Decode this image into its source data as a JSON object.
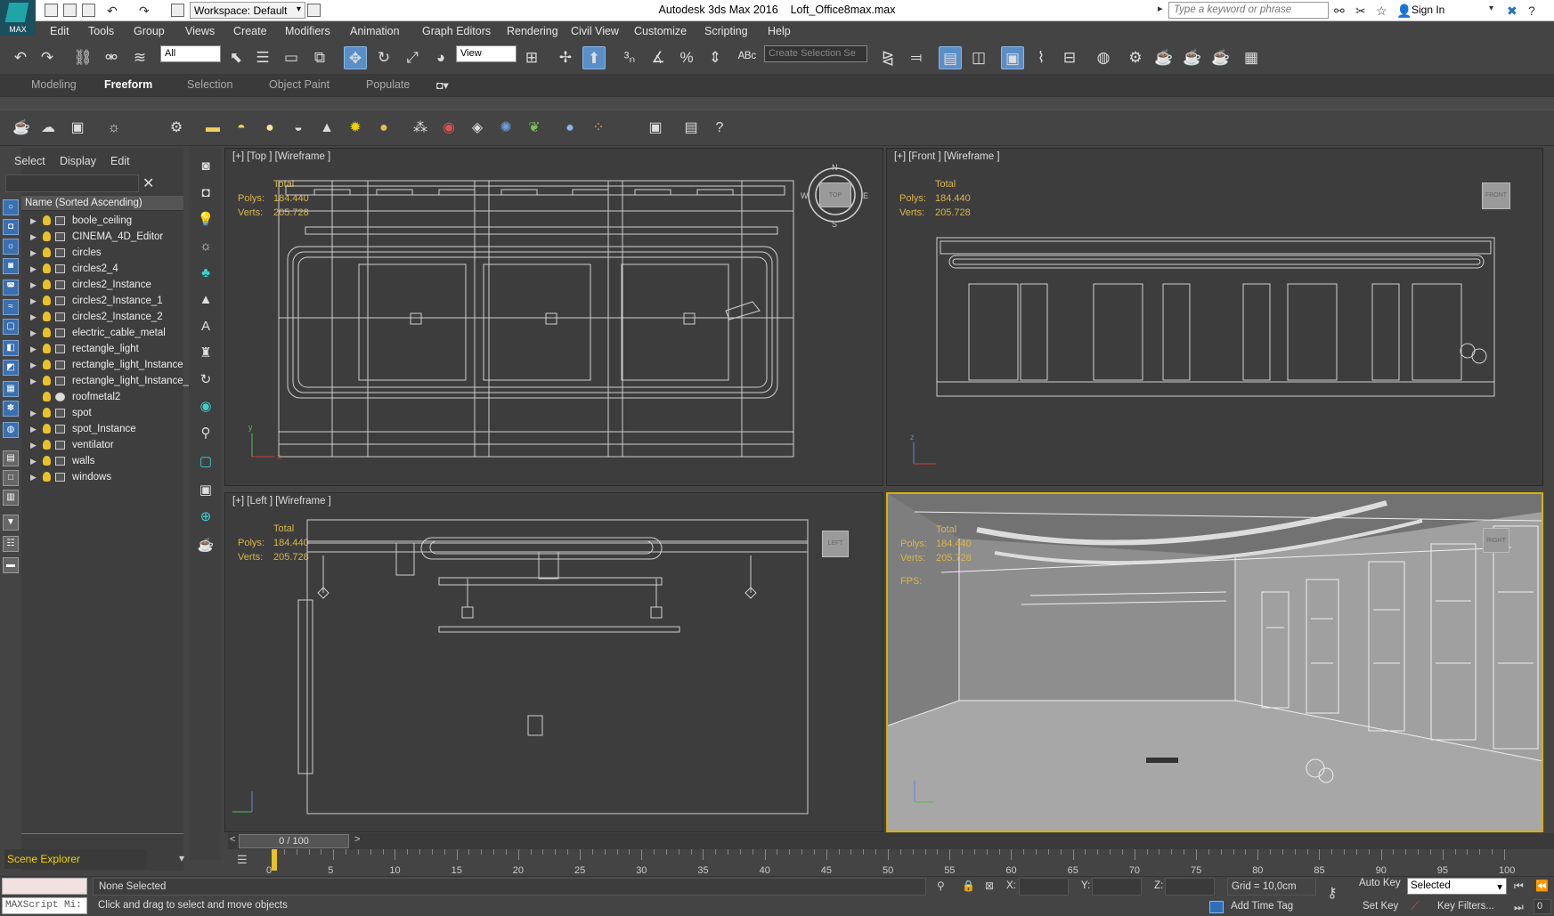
{
  "titlebar": {
    "workspace": "Workspace: Default",
    "app_title": "Autodesk 3ds Max 2016",
    "file_name": "Loft_Office8max.max",
    "search_placeholder": "Type a keyword or phrase",
    "sign_in": "Sign In",
    "logo_text": "MAX"
  },
  "menu": [
    "Edit",
    "Tools",
    "Group",
    "Views",
    "Create",
    "Modifiers",
    "Animation",
    "Graph Editors",
    "Rendering",
    "Civil View",
    "Customize",
    "Scripting",
    "Help"
  ],
  "toolbar": {
    "filter_value": "All",
    "refcoord_value": "View",
    "selection_set_placeholder": "Create Selection Se"
  },
  "ribbon": {
    "tabs": [
      "Modeling",
      "Freeform",
      "Selection",
      "Object Paint",
      "Populate"
    ],
    "active": "Freeform"
  },
  "scene_explorer": {
    "tabs": [
      "Select",
      "Display",
      "Edit"
    ],
    "header": "Name (Sorted Ascending)",
    "items": [
      "boole_ceiling",
      "CINEMA_4D_Editor",
      "circles",
      "circles2_4",
      "circles2_Instance",
      "circles2_Instance_1",
      "circles2_Instance_2",
      "electric_cable_metal",
      "rectangle_light",
      "rectangle_light_Instance",
      "rectangle_light_Instance_",
      "roofmetal2",
      "spot",
      "spot_Instance",
      "ventilator",
      "walls",
      "windows"
    ],
    "footer": "Scene Explorer"
  },
  "viewports": {
    "top": {
      "label": "[+] [Top ] [Wireframe ]",
      "compass": [
        "N",
        "E",
        "S",
        "W"
      ],
      "cube": "TOP"
    },
    "front": {
      "label": "[+] [Front ] [Wireframe ]",
      "cube": "FRONT"
    },
    "left": {
      "label": "[+] [Left ] [Wireframe ]",
      "cube": "LEFT"
    },
    "persp": {
      "fps_label": "FPS:",
      "cube": "RIGHT"
    }
  },
  "stats": {
    "total_label": "Total",
    "polys_label": "Polys:",
    "polys": "184.440",
    "verts_label": "Verts:",
    "verts": "205.728"
  },
  "timeline": {
    "frame": "0 / 100",
    "prev": "<",
    "next": ">",
    "ticks": [
      "0",
      "5",
      "10",
      "15",
      "20",
      "25",
      "30",
      "35",
      "40",
      "45",
      "50",
      "55",
      "60",
      "65",
      "70",
      "75",
      "80",
      "85",
      "90",
      "95",
      "100"
    ]
  },
  "status": {
    "maxscript": "MAXScript Mi:",
    "selection": "None Selected",
    "prompt": "Click and drag to select and move objects",
    "x_label": "X:",
    "y_label": "Y:",
    "z_label": "Z:",
    "grid": "Grid = 10,0cm",
    "add_time_tag": "Add Time Tag",
    "auto_key": "Auto Key",
    "selected_value": "Selected",
    "set_key": "Set Key",
    "key_filters": "Key Filters...",
    "frame_value": "0"
  },
  "colors": {
    "ui_bg": "#444444",
    "viewport_bg": "#3d3d3d",
    "stats": "#d9b64a",
    "active_border": "#d9b000",
    "wire": "#d8d8d8"
  }
}
